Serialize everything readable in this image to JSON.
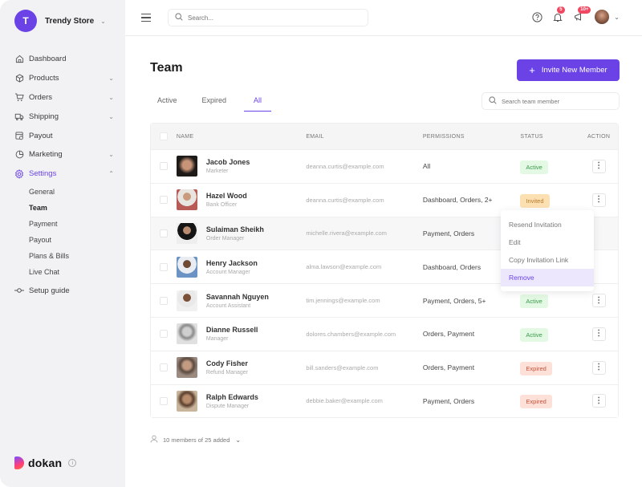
{
  "store": {
    "initial": "T",
    "name": "Trendy Store"
  },
  "sidebar": {
    "items": [
      {
        "label": "Dashboard",
        "icon": "home-icon",
        "has_chevron": false
      },
      {
        "label": "Products",
        "icon": "box-icon",
        "has_chevron": true
      },
      {
        "label": "Orders",
        "icon": "cart-icon",
        "has_chevron": true
      },
      {
        "label": "Shipping",
        "icon": "truck-icon",
        "has_chevron": true
      },
      {
        "label": "Payout",
        "icon": "payout-icon",
        "has_chevron": false
      },
      {
        "label": "Marketing",
        "icon": "pie-chart-icon",
        "has_chevron": true
      },
      {
        "label": "Settings",
        "icon": "gear-icon",
        "has_chevron": true,
        "expanded": true,
        "active": true
      }
    ],
    "settings_sub": [
      "General",
      "Team",
      "Payment",
      "Payout",
      "Plans & Bills",
      "Live Chat"
    ],
    "active_sub": "Team",
    "setup_guide": "Setup guide"
  },
  "brand": {
    "name": "dokan"
  },
  "topbar": {
    "search_placeholder": "Search...",
    "notifications_badge": "5",
    "announcements_badge": "10+"
  },
  "page": {
    "title": "Team",
    "invite_button": "Invite New Member",
    "tabs": [
      "Active",
      "Expired",
      "All"
    ],
    "active_tab": "All",
    "search_placeholder": "Search team member"
  },
  "table": {
    "headers": {
      "name": "NAME",
      "email": "EMAIL",
      "permissions": "PERMISSIONS",
      "status": "STATUS",
      "action": "ACTION"
    },
    "rows": [
      {
        "name": "Jacob Jones",
        "role": "Marketer",
        "email": "deanna.curtis@example.com",
        "permissions": "All",
        "status": "Active"
      },
      {
        "name": "Hazel Wood",
        "role": "Bank Officer",
        "email": "deanna.curtis@example.com",
        "permissions": "Dashboard, Orders, 2+",
        "status": "Invited"
      },
      {
        "name": "Sulaiman Sheikh",
        "role": "Order Manager",
        "email": "michelle.rivera@example.com",
        "permissions": "Payment, Orders",
        "status": ""
      },
      {
        "name": "Henry Jackson",
        "role": "Account Manager",
        "email": "alma.lawson@example.com",
        "permissions": "Dashboard, Orders",
        "status": ""
      },
      {
        "name": "Savannah Nguyen",
        "role": "Account Assistant",
        "email": "tim.jennings@example.com",
        "permissions": "Payment, Orders, 5+",
        "status": "Active"
      },
      {
        "name": "Dianne Russell",
        "role": "Manager",
        "email": "dolores.chambers@example.com",
        "permissions": "Orders, Payment",
        "status": "Active"
      },
      {
        "name": "Cody Fisher",
        "role": "Refund Manager",
        "email": "bill.sanders@example.com",
        "permissions": "Orders, Payment",
        "status": "Expired"
      },
      {
        "name": "Ralph Edwards",
        "role": "Dispute Manager",
        "email": "debbie.baker@example.com",
        "permissions": "Payment, Orders",
        "status": "Expired"
      }
    ]
  },
  "action_menu": {
    "items": [
      "Resend Invitation",
      "Edit",
      "Copy Invitation Link",
      "Remove"
    ],
    "selected": "Remove"
  },
  "footer": {
    "count_text": "10 members of 25 added"
  },
  "colors": {
    "accent": "#6a42e6",
    "active": "#3a9a4c",
    "invited": "#b67a2a",
    "expired": "#c5503b",
    "badge": "#f04860"
  }
}
